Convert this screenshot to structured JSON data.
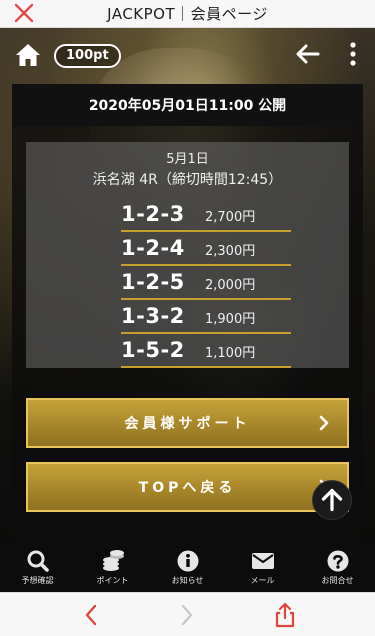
{
  "browser": {
    "title": "JACKPOT｜会員ページ",
    "close_icon": "close-icon",
    "bottom": {
      "back_icon": "chevron-left-icon",
      "forward_icon": "chevron-right-icon",
      "share_icon": "share-icon"
    }
  },
  "nav": {
    "home_icon": "home-icon",
    "points": "100pt",
    "back_icon": "arrow-left-icon",
    "more_icon": "more-vertical-icon"
  },
  "panel": {
    "header": "2020年05月01日11:00 公開",
    "card": {
      "date": "5月1日",
      "race": "浜名湖 4R（締切時間12:45）",
      "results": [
        {
          "combo": "1-2-3",
          "price": "2,700円"
        },
        {
          "combo": "1-2-4",
          "price": "2,300円"
        },
        {
          "combo": "1-2-5",
          "price": "2,000円"
        },
        {
          "combo": "1-3-2",
          "price": "1,900円"
        },
        {
          "combo": "1-5-2",
          "price": "1,100円"
        }
      ]
    },
    "buttons": {
      "support": "会員様サポート",
      "top": "TOPへ戻る"
    }
  },
  "tabbar": [
    {
      "label": "予想確認",
      "icon": "search-icon"
    },
    {
      "label": "ポイント",
      "icon": "coins-icon"
    },
    {
      "label": "お知らせ",
      "icon": "info-icon"
    },
    {
      "label": "メール",
      "icon": "mail-icon"
    },
    {
      "label": "お問合せ",
      "icon": "question-icon"
    }
  ],
  "colors": {
    "accent_gold": "#c6a339",
    "border_gold": "#e8c45a",
    "close_red": "#e84b4b",
    "share_red": "#e0473c"
  }
}
